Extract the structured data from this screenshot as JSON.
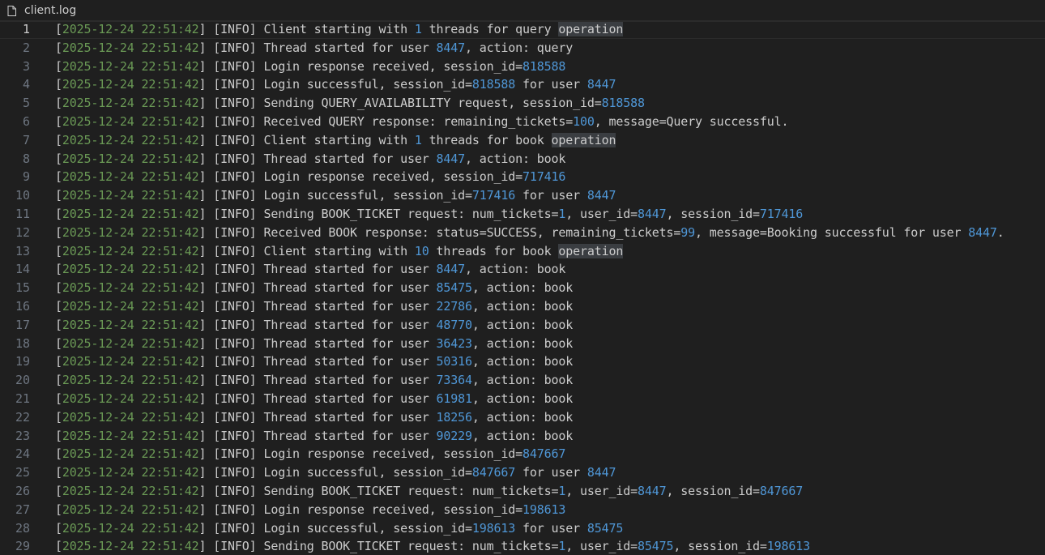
{
  "tab": {
    "filename": "client.log",
    "icon": "file-icon"
  },
  "colors": {
    "background": "#1f1f1f",
    "text": "#cccccc",
    "timestamp": "#6a9955",
    "number": "#4f97d7",
    "line_number": "#6e7681",
    "highlight": "#3a3d41"
  },
  "lines": [
    {
      "n": "1",
      "ts": "2025-12-24 22:51:42",
      "level": "INFO",
      "segs": [
        {
          "t": "Client starting with "
        },
        {
          "t": "1",
          "k": "num"
        },
        {
          "t": " threads for query "
        },
        {
          "t": "operation",
          "k": "hl"
        }
      ]
    },
    {
      "n": "2",
      "ts": "2025-12-24 22:51:42",
      "level": "INFO",
      "segs": [
        {
          "t": "Thread started for user "
        },
        {
          "t": "8447",
          "k": "num"
        },
        {
          "t": ", action: query"
        }
      ]
    },
    {
      "n": "3",
      "ts": "2025-12-24 22:51:42",
      "level": "INFO",
      "segs": [
        {
          "t": "Login response received, session_id="
        },
        {
          "t": "818588",
          "k": "num"
        }
      ]
    },
    {
      "n": "4",
      "ts": "2025-12-24 22:51:42",
      "level": "INFO",
      "segs": [
        {
          "t": "Login successful, session_id="
        },
        {
          "t": "818588",
          "k": "num"
        },
        {
          "t": " for user "
        },
        {
          "t": "8447",
          "k": "num"
        }
      ]
    },
    {
      "n": "5",
      "ts": "2025-12-24 22:51:42",
      "level": "INFO",
      "segs": [
        {
          "t": "Sending QUERY_AVAILABILITY request, session_id="
        },
        {
          "t": "818588",
          "k": "num"
        }
      ]
    },
    {
      "n": "6",
      "ts": "2025-12-24 22:51:42",
      "level": "INFO",
      "segs": [
        {
          "t": "Received QUERY response: remaining_tickets="
        },
        {
          "t": "100",
          "k": "num"
        },
        {
          "t": ", message=Query successful."
        }
      ]
    },
    {
      "n": "7",
      "ts": "2025-12-24 22:51:42",
      "level": "INFO",
      "segs": [
        {
          "t": "Client starting with "
        },
        {
          "t": "1",
          "k": "num"
        },
        {
          "t": " threads for book "
        },
        {
          "t": "operation",
          "k": "hl"
        }
      ]
    },
    {
      "n": "8",
      "ts": "2025-12-24 22:51:42",
      "level": "INFO",
      "segs": [
        {
          "t": "Thread started for user "
        },
        {
          "t": "8447",
          "k": "num"
        },
        {
          "t": ", action: book"
        }
      ]
    },
    {
      "n": "9",
      "ts": "2025-12-24 22:51:42",
      "level": "INFO",
      "segs": [
        {
          "t": "Login response received, session_id="
        },
        {
          "t": "717416",
          "k": "num"
        }
      ]
    },
    {
      "n": "10",
      "ts": "2025-12-24 22:51:42",
      "level": "INFO",
      "segs": [
        {
          "t": "Login successful, session_id="
        },
        {
          "t": "717416",
          "k": "num"
        },
        {
          "t": " for user "
        },
        {
          "t": "8447",
          "k": "num"
        }
      ]
    },
    {
      "n": "11",
      "ts": "2025-12-24 22:51:42",
      "level": "INFO",
      "segs": [
        {
          "t": "Sending BOOK_TICKET request: num_tickets="
        },
        {
          "t": "1",
          "k": "num"
        },
        {
          "t": ", user_id="
        },
        {
          "t": "8447",
          "k": "num"
        },
        {
          "t": ", session_id="
        },
        {
          "t": "717416",
          "k": "num"
        }
      ]
    },
    {
      "n": "12",
      "ts": "2025-12-24 22:51:42",
      "level": "INFO",
      "segs": [
        {
          "t": "Received BOOK response: status=SUCCESS, remaining_tickets="
        },
        {
          "t": "99",
          "k": "num"
        },
        {
          "t": ", message=Booking successful for user "
        },
        {
          "t": "8447",
          "k": "num"
        },
        {
          "t": "."
        }
      ]
    },
    {
      "n": "13",
      "ts": "2025-12-24 22:51:42",
      "level": "INFO",
      "segs": [
        {
          "t": "Client starting with "
        },
        {
          "t": "10",
          "k": "num"
        },
        {
          "t": " threads for book "
        },
        {
          "t": "operation",
          "k": "hl"
        }
      ]
    },
    {
      "n": "14",
      "ts": "2025-12-24 22:51:42",
      "level": "INFO",
      "segs": [
        {
          "t": "Thread started for user "
        },
        {
          "t": "8447",
          "k": "num"
        },
        {
          "t": ", action: book"
        }
      ]
    },
    {
      "n": "15",
      "ts": "2025-12-24 22:51:42",
      "level": "INFO",
      "segs": [
        {
          "t": "Thread started for user "
        },
        {
          "t": "85475",
          "k": "num"
        },
        {
          "t": ", action: book"
        }
      ]
    },
    {
      "n": "16",
      "ts": "2025-12-24 22:51:42",
      "level": "INFO",
      "segs": [
        {
          "t": "Thread started for user "
        },
        {
          "t": "22786",
          "k": "num"
        },
        {
          "t": ", action: book"
        }
      ]
    },
    {
      "n": "17",
      "ts": "2025-12-24 22:51:42",
      "level": "INFO",
      "segs": [
        {
          "t": "Thread started for user "
        },
        {
          "t": "48770",
          "k": "num"
        },
        {
          "t": ", action: book"
        }
      ]
    },
    {
      "n": "18",
      "ts": "2025-12-24 22:51:42",
      "level": "INFO",
      "segs": [
        {
          "t": "Thread started for user "
        },
        {
          "t": "36423",
          "k": "num"
        },
        {
          "t": ", action: book"
        }
      ]
    },
    {
      "n": "19",
      "ts": "2025-12-24 22:51:42",
      "level": "INFO",
      "segs": [
        {
          "t": "Thread started for user "
        },
        {
          "t": "50316",
          "k": "num"
        },
        {
          "t": ", action: book"
        }
      ]
    },
    {
      "n": "20",
      "ts": "2025-12-24 22:51:42",
      "level": "INFO",
      "segs": [
        {
          "t": "Thread started for user "
        },
        {
          "t": "73364",
          "k": "num"
        },
        {
          "t": ", action: book"
        }
      ]
    },
    {
      "n": "21",
      "ts": "2025-12-24 22:51:42",
      "level": "INFO",
      "segs": [
        {
          "t": "Thread started for user "
        },
        {
          "t": "61981",
          "k": "num"
        },
        {
          "t": ", action: book"
        }
      ]
    },
    {
      "n": "22",
      "ts": "2025-12-24 22:51:42",
      "level": "INFO",
      "segs": [
        {
          "t": "Thread started for user "
        },
        {
          "t": "18256",
          "k": "num"
        },
        {
          "t": ", action: book"
        }
      ]
    },
    {
      "n": "23",
      "ts": "2025-12-24 22:51:42",
      "level": "INFO",
      "segs": [
        {
          "t": "Thread started for user "
        },
        {
          "t": "90229",
          "k": "num"
        },
        {
          "t": ", action: book"
        }
      ]
    },
    {
      "n": "24",
      "ts": "2025-12-24 22:51:42",
      "level": "INFO",
      "segs": [
        {
          "t": "Login response received, session_id="
        },
        {
          "t": "847667",
          "k": "num"
        }
      ]
    },
    {
      "n": "25",
      "ts": "2025-12-24 22:51:42",
      "level": "INFO",
      "segs": [
        {
          "t": "Login successful, session_id="
        },
        {
          "t": "847667",
          "k": "num"
        },
        {
          "t": " for user "
        },
        {
          "t": "8447",
          "k": "num"
        }
      ]
    },
    {
      "n": "26",
      "ts": "2025-12-24 22:51:42",
      "level": "INFO",
      "segs": [
        {
          "t": "Sending BOOK_TICKET request: num_tickets="
        },
        {
          "t": "1",
          "k": "num"
        },
        {
          "t": ", user_id="
        },
        {
          "t": "8447",
          "k": "num"
        },
        {
          "t": ", session_id="
        },
        {
          "t": "847667",
          "k": "num"
        }
      ]
    },
    {
      "n": "27",
      "ts": "2025-12-24 22:51:42",
      "level": "INFO",
      "segs": [
        {
          "t": "Login response received, session_id="
        },
        {
          "t": "198613",
          "k": "num"
        }
      ]
    },
    {
      "n": "28",
      "ts": "2025-12-24 22:51:42",
      "level": "INFO",
      "segs": [
        {
          "t": "Login successful, session_id="
        },
        {
          "t": "198613",
          "k": "num"
        },
        {
          "t": " for user "
        },
        {
          "t": "85475",
          "k": "num"
        }
      ]
    },
    {
      "n": "29",
      "ts": "2025-12-24 22:51:42",
      "level": "INFO",
      "segs": [
        {
          "t": "Sending BOOK_TICKET request: num_tickets="
        },
        {
          "t": "1",
          "k": "num"
        },
        {
          "t": ", user_id="
        },
        {
          "t": "85475",
          "k": "num"
        },
        {
          "t": ", session_id="
        },
        {
          "t": "198613",
          "k": "num"
        }
      ]
    }
  ]
}
